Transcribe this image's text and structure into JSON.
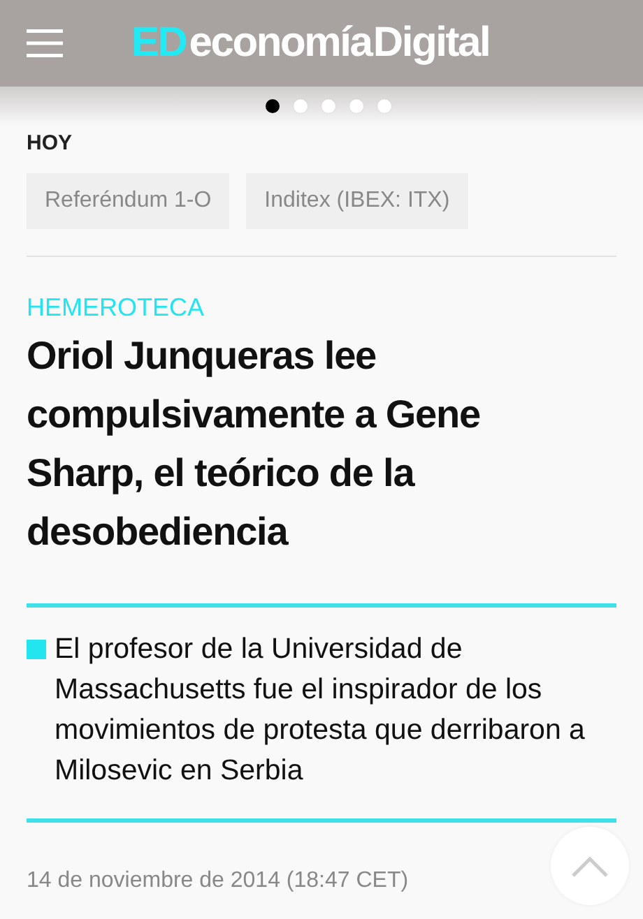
{
  "header": {
    "logo_mark": "ED",
    "logo_text": "economía Digital"
  },
  "pager": [
    {
      "selected": true
    },
    {
      "selected": false
    },
    {
      "selected": false
    },
    {
      "selected": false
    },
    {
      "selected": false
    }
  ],
  "today": {
    "heading": "HOY",
    "tags": [
      "Referéndum 1-O",
      "Inditex (IBEX: ITX)"
    ]
  },
  "article": {
    "section": "HEMEROTECA",
    "title": "Oriol Junqueras lee compulsivamente a Gene Sharp, el teórico de la desobediencia",
    "lead": "El profesor de la Universidad de Massachusetts fue el inspirador de los movimientos de protesta que derribaron a Milosevic en Serbia",
    "date": "14 de noviembre de 2014 (18:47 CET)"
  }
}
